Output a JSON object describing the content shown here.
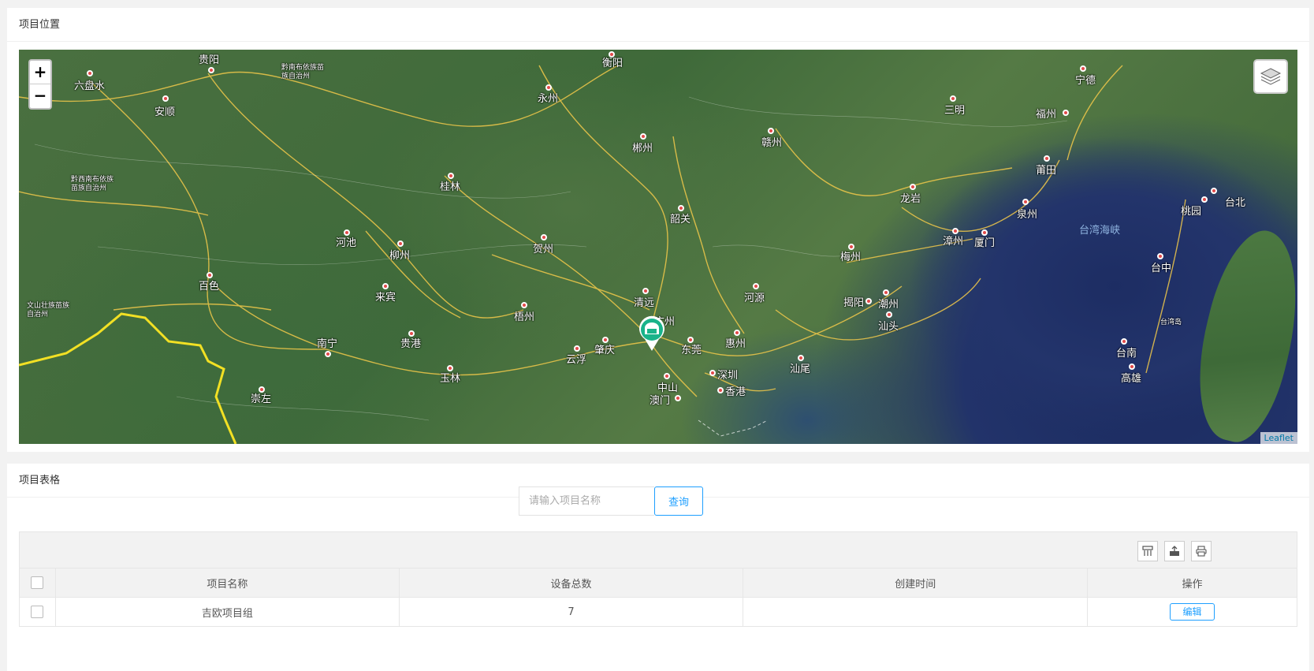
{
  "map_panel": {
    "title": "项目位置",
    "zoom_in": "+",
    "zoom_out": "−",
    "attribution": "Leaflet",
    "cities": [
      {
        "name": "贵阳",
        "small": false
      },
      {
        "name": "六盘水",
        "small": false
      },
      {
        "name": "安顺",
        "small": false
      },
      {
        "name": "黔南布依族苗族自治州",
        "small": true
      },
      {
        "name": "黔西南布依族苗族自治州",
        "small": true
      },
      {
        "name": "衡阳",
        "small": false
      },
      {
        "name": "永州",
        "small": false
      },
      {
        "name": "郴州",
        "small": false
      },
      {
        "name": "赣州",
        "small": false
      },
      {
        "name": "三明",
        "small": false
      },
      {
        "name": "宁德",
        "small": false
      },
      {
        "name": "福州",
        "small": false
      },
      {
        "name": "莆田",
        "small": false
      },
      {
        "name": "泉州",
        "small": false
      },
      {
        "name": "龙岩",
        "small": false
      },
      {
        "name": "漳州",
        "small": false
      },
      {
        "name": "厦门",
        "small": false
      },
      {
        "name": "桂林",
        "small": false
      },
      {
        "name": "韶关",
        "small": false
      },
      {
        "name": "河池",
        "small": false
      },
      {
        "name": "柳州",
        "small": false
      },
      {
        "name": "贺州",
        "small": false
      },
      {
        "name": "梅州",
        "small": false
      },
      {
        "name": "百色",
        "small": false
      },
      {
        "name": "来宾",
        "small": false
      },
      {
        "name": "清远",
        "small": false
      },
      {
        "name": "广州",
        "small": false
      },
      {
        "name": "河源",
        "small": false
      },
      {
        "name": "揭阳",
        "small": false
      },
      {
        "name": "潮州",
        "small": false
      },
      {
        "name": "汕头",
        "small": false
      },
      {
        "name": "梧州",
        "small": false
      },
      {
        "name": "南宁",
        "small": false
      },
      {
        "name": "贵港",
        "small": false
      },
      {
        "name": "肇庆",
        "small": false
      },
      {
        "name": "东莞",
        "small": false
      },
      {
        "name": "惠州",
        "small": false
      },
      {
        "name": "云浮",
        "small": false
      },
      {
        "name": "汕尾",
        "small": false
      },
      {
        "name": "玉林",
        "small": false
      },
      {
        "name": "深圳",
        "small": false
      },
      {
        "name": "中山",
        "small": false
      },
      {
        "name": "香港",
        "small": false
      },
      {
        "name": "澳门",
        "small": false
      },
      {
        "name": "崇左",
        "small": false
      },
      {
        "name": "文山壮族苗族自治州",
        "small": true
      },
      {
        "name": "台湾海峡",
        "small": false
      },
      {
        "name": "桃园",
        "small": false
      },
      {
        "name": "台北",
        "small": false
      },
      {
        "name": "台中",
        "small": false
      },
      {
        "name": "台南",
        "small": false
      },
      {
        "name": "高雄",
        "small": false
      },
      {
        "name": "台湾岛",
        "small": true
      }
    ]
  },
  "table_panel": {
    "title": "项目表格",
    "search": {
      "placeholder": "请输入项目名称",
      "button": "查询"
    },
    "columns": [
      "项目名称",
      "设备总数",
      "创建时间",
      "操作"
    ],
    "rows": [
      {
        "name": "吉欧项目组",
        "device_count": "7",
        "created": "",
        "action": "编辑"
      }
    ],
    "toolbar_icons": [
      "columns-icon",
      "export-icon",
      "print-icon"
    ]
  },
  "colors": {
    "accent": "#1e9fff",
    "marker": "#19b38a",
    "road": "#f0c84a"
  }
}
